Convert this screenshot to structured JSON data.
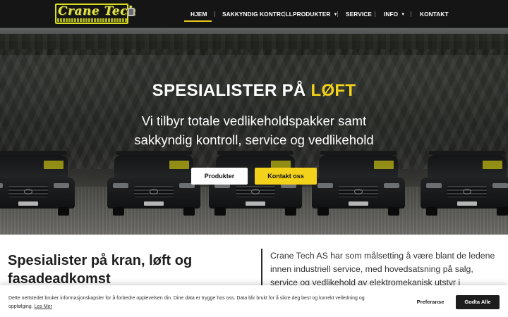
{
  "logo": {
    "text": "Crane Tech"
  },
  "nav": {
    "items": [
      {
        "label": "HJEM",
        "active": true,
        "has_dropdown": false
      },
      {
        "label": "SAKKYNDIG KONTROLL",
        "has_dropdown": false
      },
      {
        "label": "PRODUKTER",
        "has_dropdown": true
      },
      {
        "label": "SERVICE",
        "has_dropdown": false
      },
      {
        "label": "INFO",
        "has_dropdown": true
      },
      {
        "label": "KONTAKT",
        "has_dropdown": false
      }
    ],
    "dropdown_icon": "chevron-down-icon"
  },
  "hero": {
    "title_main": "SPESIALISTER PÅ ",
    "title_accent": "LØFT",
    "subtitle": "Vi tilbyr totale vedlikeholdspakker samt sakkyndig kontroll, service og vedlikehold",
    "button_products": "Produkter",
    "button_contact": "Kontakt oss"
  },
  "content": {
    "title": "Spesialister på kran, løft og fasadeadkomst",
    "text": "Crane Tech AS har som målsetting å være blant de ledene innen industriell service, med hovedsatsning på salg, service og vedlikehold av elektromekanisk utstyr i maskinparken deres."
  },
  "cookie": {
    "text": "Dette nettstedet bruker informasjonskapsler for å forbedre opplevelsen din. Dine data er trygge hos oss. Data blir brukt for å sikre deg best og korrekt veiledning og oppfølging. ",
    "link": "Les Mer",
    "preferences": "Preferanse",
    "accept": "Godta Alle"
  },
  "colors": {
    "header_bg": "#151515",
    "accent_yellow": "#f2d21a",
    "logo_yellow": "#e3e64a",
    "accept_bg": "#1d1d1d"
  }
}
